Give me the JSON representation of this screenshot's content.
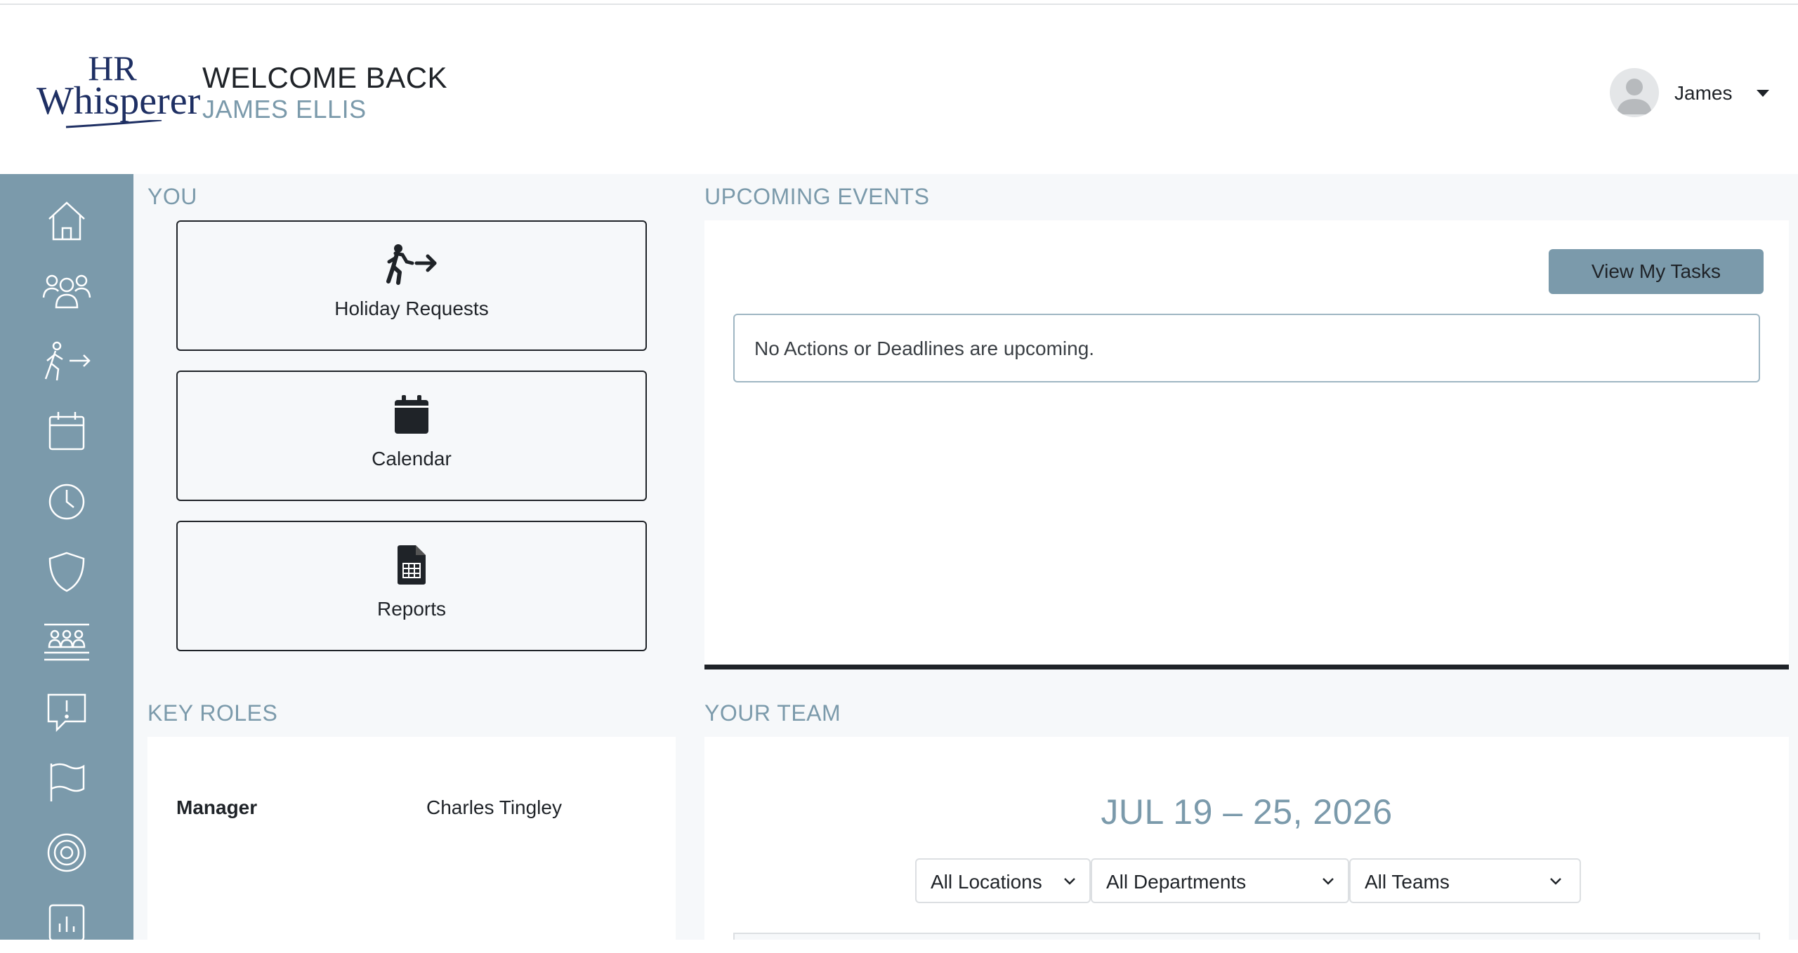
{
  "brand": {
    "logo_line1": "HR",
    "logo_line2": "Whisperer",
    "navy": "#1e2f63"
  },
  "header": {
    "welcome": "WELCOME BACK",
    "user_fullname": "JAMES ELLIS",
    "user_menu_name": "James"
  },
  "colors": {
    "accent": "#7b9aab",
    "text": "#1f2328",
    "background": "#f6f8fa"
  },
  "sidebar": {
    "items": [
      {
        "icon": "home-icon"
      },
      {
        "icon": "people-icon"
      },
      {
        "icon": "walking-out-icon"
      },
      {
        "icon": "calendar-icon"
      },
      {
        "icon": "clock-icon"
      },
      {
        "icon": "shield-icon"
      },
      {
        "icon": "team-group-icon"
      },
      {
        "icon": "alert-message-icon"
      },
      {
        "icon": "flag-icon"
      },
      {
        "icon": "target-icon"
      },
      {
        "icon": "bar-chart-icon"
      }
    ]
  },
  "you": {
    "title": "YOU",
    "tiles": [
      {
        "label": "Holiday Requests",
        "icon": "walking-out-icon"
      },
      {
        "label": "Calendar",
        "icon": "calendar-icon"
      },
      {
        "label": "Reports",
        "icon": "spreadsheet-icon"
      }
    ]
  },
  "events": {
    "title": "UPCOMING EVENTS",
    "button_label": "View My Tasks",
    "empty_message": "No Actions or Deadlines are upcoming."
  },
  "key_roles": {
    "title": "KEY ROLES",
    "rows": [
      {
        "role": "Manager",
        "name": "Charles Tingley"
      }
    ]
  },
  "team": {
    "title": "YOUR TEAM",
    "date_range": "JUL 19 – 25, 2026",
    "filters": [
      {
        "selected": "All Locations"
      },
      {
        "selected": "All Departments"
      },
      {
        "selected": "All Teams"
      }
    ]
  }
}
